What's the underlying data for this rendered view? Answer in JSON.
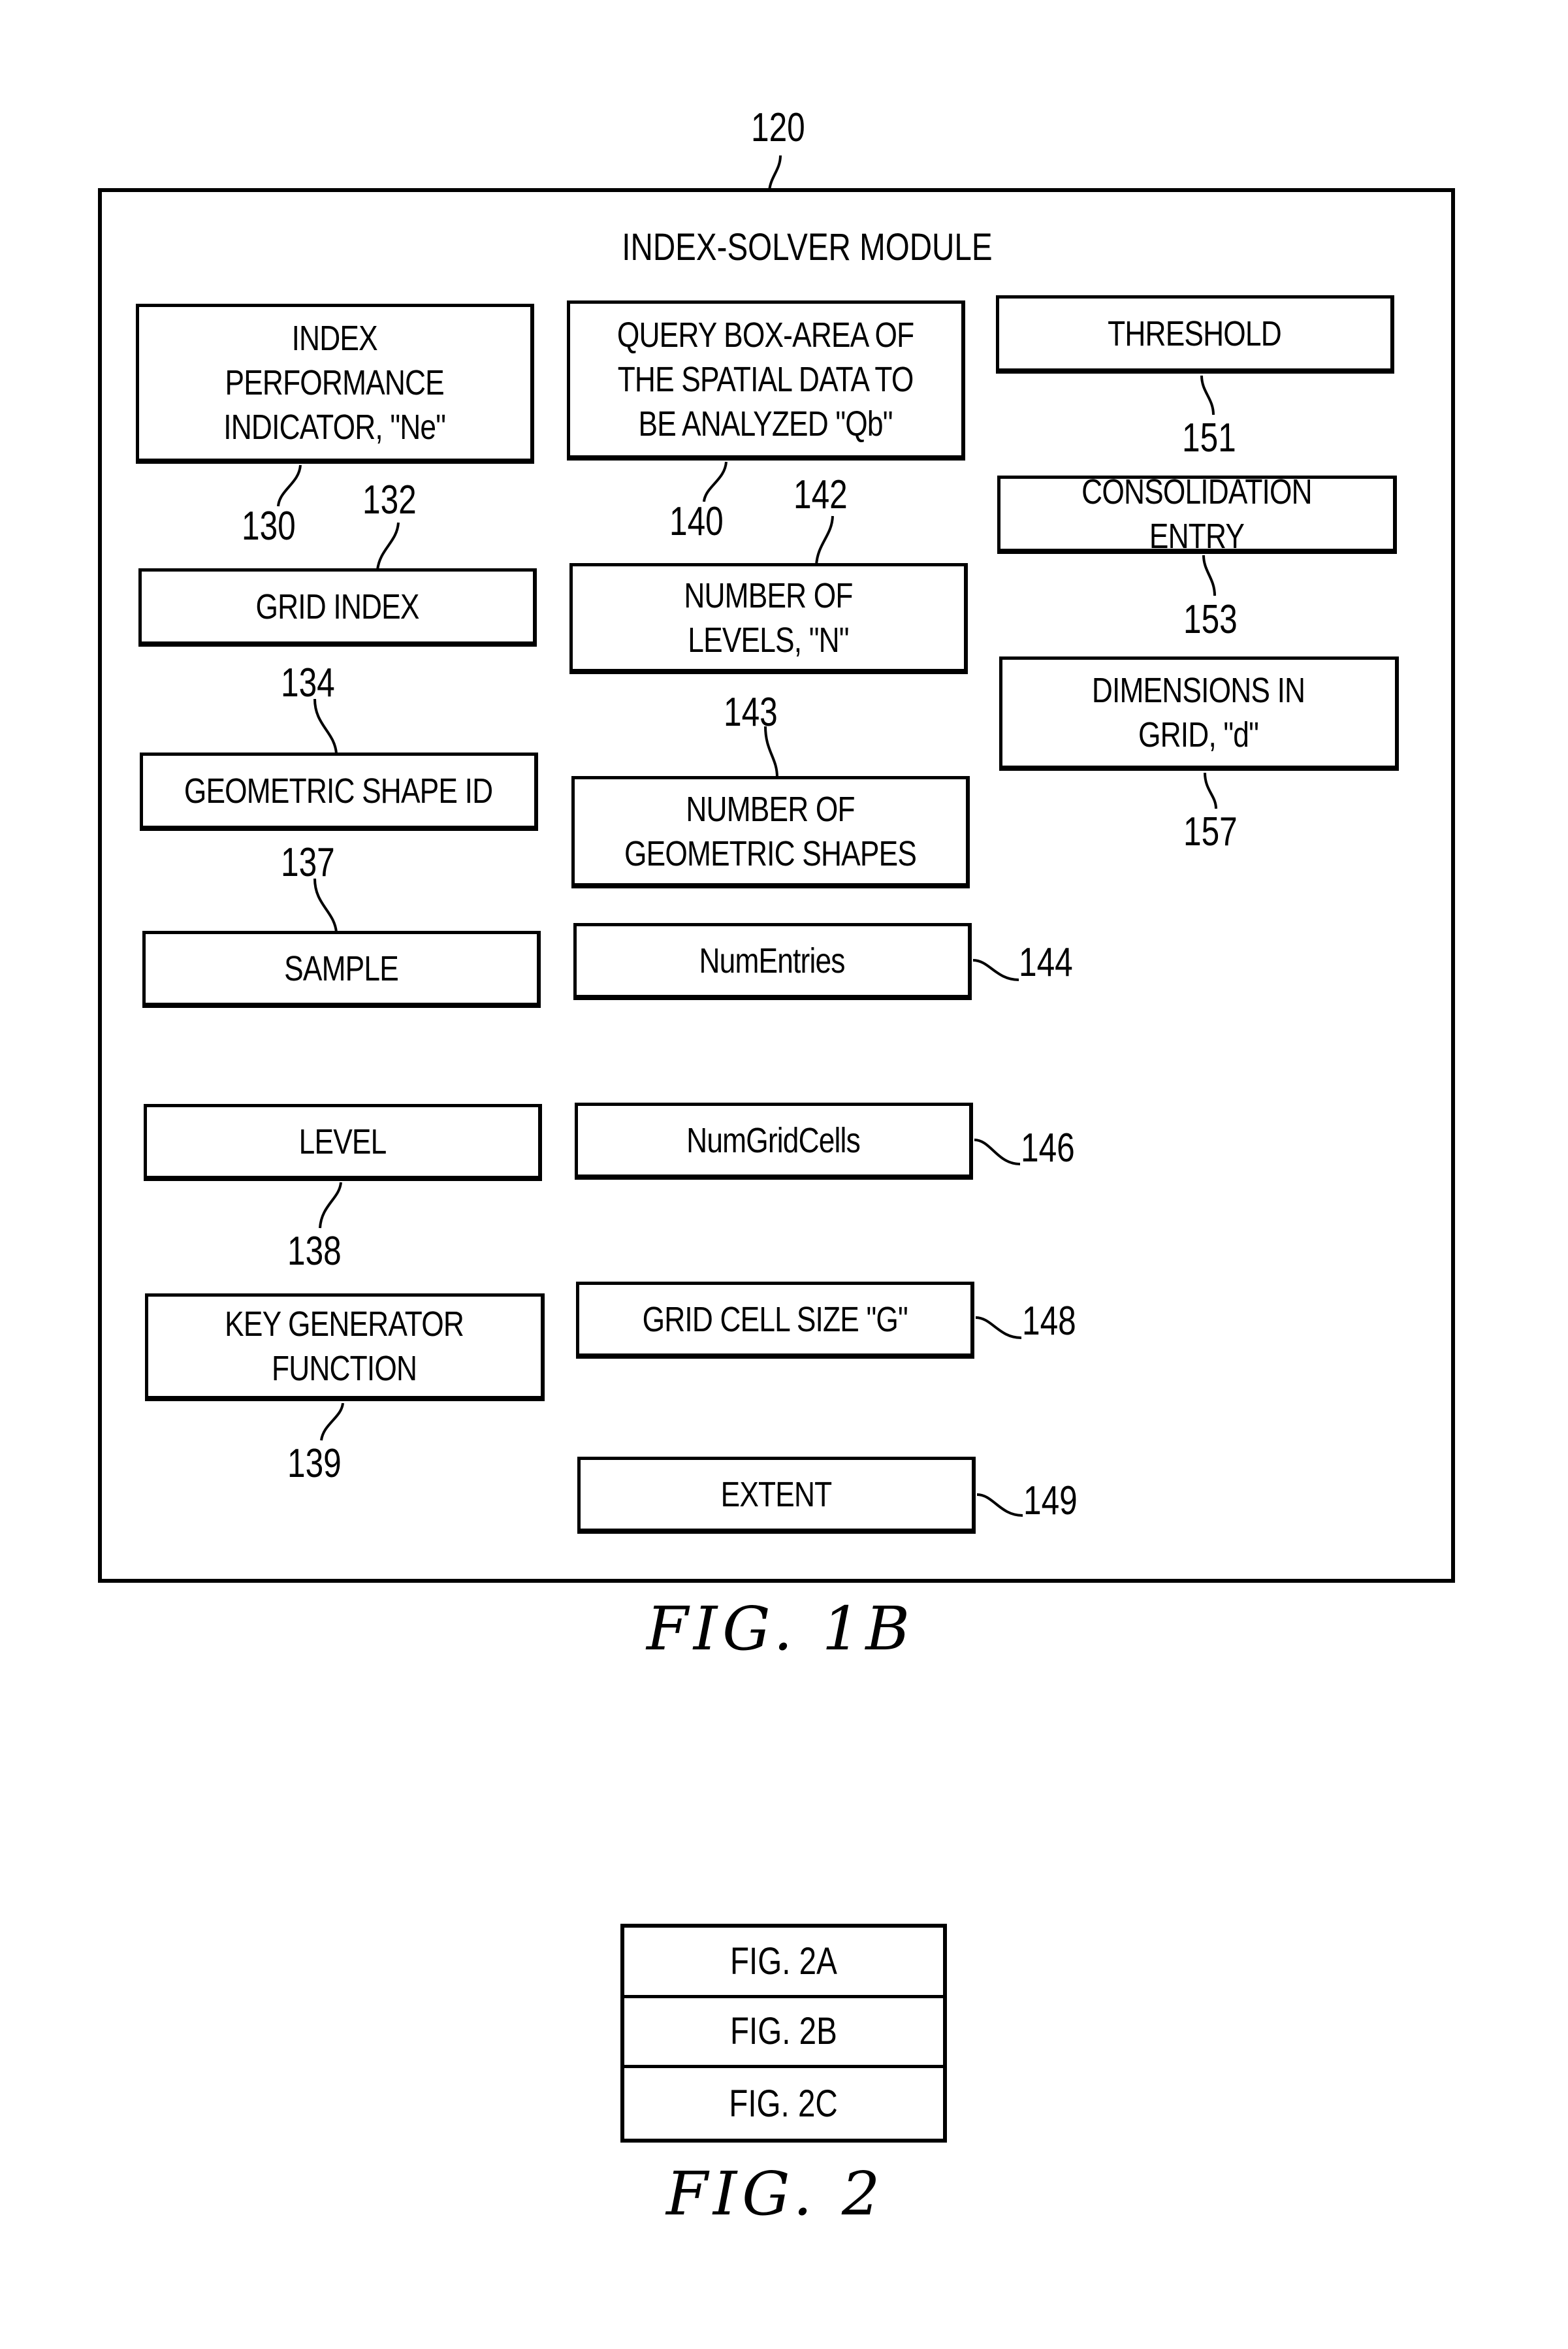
{
  "figure_1b": {
    "module_ref": "120",
    "module_title": "INDEX-SOLVER MODULE",
    "caption": "FIG. 1B",
    "boxes": [
      {
        "id": "index-performance-indicator",
        "label": "INDEX\nPERFORMANCE\nINDICATOR, \"Ne\"",
        "ref": "130"
      },
      {
        "id": "grid-index",
        "label": "GRID INDEX",
        "ref": "132"
      },
      {
        "id": "geometric-shape-id",
        "label": "GEOMETRIC SHAPE ID",
        "ref": "134"
      },
      {
        "id": "sample",
        "label": "SAMPLE",
        "ref": "137"
      },
      {
        "id": "level",
        "label": "LEVEL",
        "ref": "138"
      },
      {
        "id": "key-generator-function",
        "label": "KEY GENERATOR\nFUNCTION",
        "ref": "139"
      },
      {
        "id": "query-box-area",
        "label": "QUERY BOX-AREA OF\nTHE SPATIAL DATA TO\nBE ANALYZED \"Qb\"",
        "ref": "140"
      },
      {
        "id": "number-of-levels",
        "label": "NUMBER OF\nLEVELS, \"N\"",
        "ref": "142"
      },
      {
        "id": "number-of-geometric-shapes",
        "label": "NUMBER OF\nGEOMETRIC SHAPES",
        "ref": "143"
      },
      {
        "id": "num-entries",
        "label": "NumEntries",
        "ref": "144"
      },
      {
        "id": "num-grid-cells",
        "label": "NumGridCells",
        "ref": "146"
      },
      {
        "id": "grid-cell-size",
        "label": "GRID CELL SIZE \"G\"",
        "ref": "148"
      },
      {
        "id": "extent",
        "label": "EXTENT",
        "ref": "149"
      },
      {
        "id": "threshold",
        "label": "THRESHOLD",
        "ref": "151"
      },
      {
        "id": "consolidation-entry",
        "label": "CONSOLIDATION ENTRY",
        "ref": "153"
      },
      {
        "id": "dimensions-in-grid",
        "label": "DIMENSIONS IN\nGRID, \"d\"",
        "ref": "157"
      }
    ]
  },
  "figure_2": {
    "caption": "FIG. 2",
    "rows": [
      "FIG. 2A",
      "FIG. 2B",
      "FIG. 2C"
    ]
  }
}
